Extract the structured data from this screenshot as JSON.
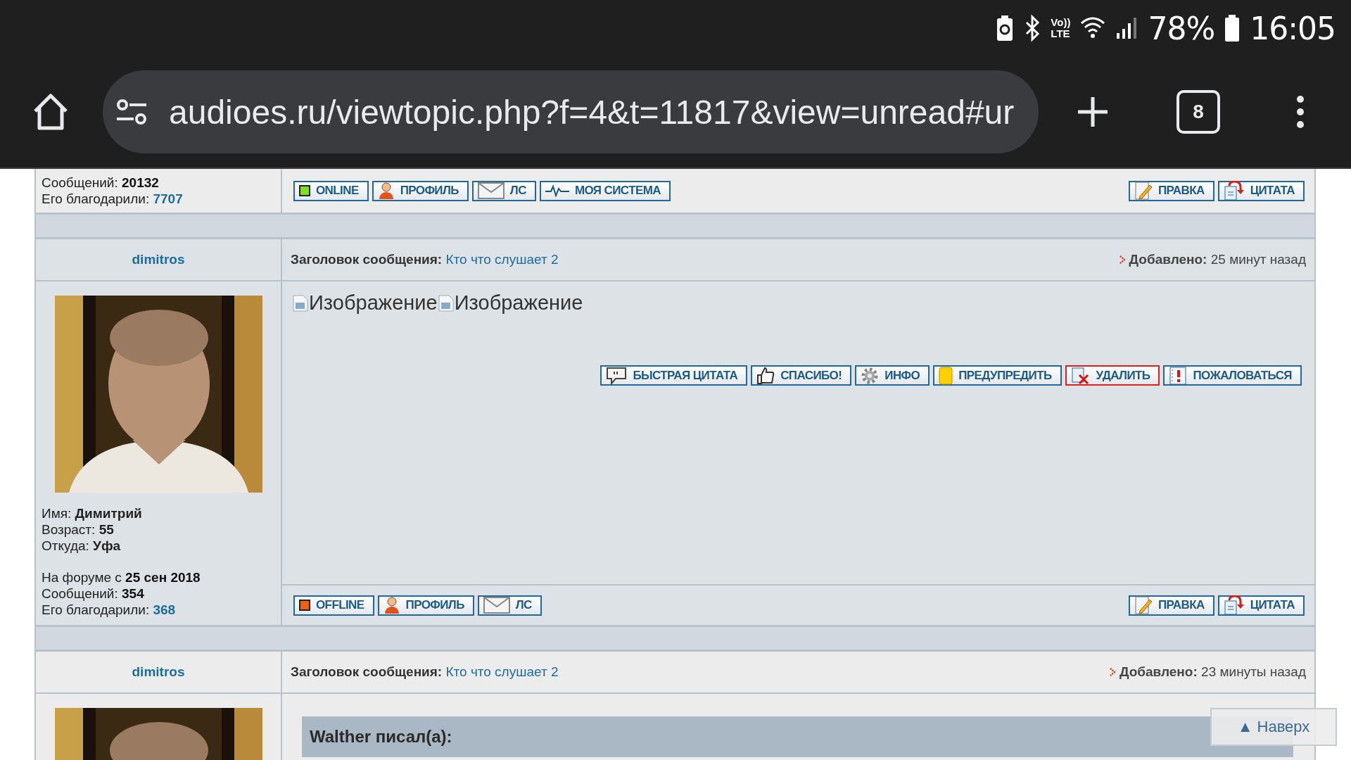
{
  "status_bar": {
    "indicator_top": "Vo))",
    "indicator_bottom": "LTE",
    "battery": "78%",
    "time": "16:05"
  },
  "browser": {
    "url": "audioes.ru/viewtopic.php?f=4&t=11817&view=unread#ur",
    "tab_count": "8"
  },
  "posts": [
    {
      "stats": [
        {
          "label": "Сообщений:",
          "value": "20132",
          "kind": "bold"
        },
        {
          "label": "Его благодарили:",
          "value": "7707",
          "kind": "link"
        }
      ],
      "footer_buttons": [
        {
          "kind": "online",
          "label": "ONLINE"
        },
        {
          "kind": "profile",
          "label": "ПРОФИЛЬ"
        },
        {
          "kind": "pm",
          "label": "ЛС"
        },
        {
          "kind": "system",
          "label": "МОЯ СИСТЕМА"
        }
      ],
      "edit_buttons": [
        {
          "kind": "edit",
          "label": "ПРАВКА"
        },
        {
          "kind": "quote",
          "label": "ЦИТАТА"
        }
      ]
    },
    {
      "author": "dimitros",
      "subject_label": "Заголовок сообщения:",
      "subject": "Кто что слушает 2",
      "added_label": "Добавлено:",
      "added": "25 минут назад",
      "avatar": {
        "kind": "picture"
      },
      "images": [
        "Изображение",
        "Изображение"
      ],
      "action_buttons": [
        {
          "kind": "quickquote",
          "label": "БЫСТРАЯ ЦИТАТА"
        },
        {
          "kind": "thanks",
          "label": "СПАСИБО!"
        },
        {
          "kind": "info",
          "label": "ИНФО"
        },
        {
          "kind": "warn",
          "label": "ПРЕДУПРЕДИТЬ"
        },
        {
          "kind": "delete",
          "label": "УДАЛИТЬ"
        },
        {
          "kind": "report",
          "label": "ПОЖАЛОВАТЬСЯ"
        }
      ],
      "details": [
        {
          "label": "Имя:",
          "value": "Димитрий"
        },
        {
          "label": "Возраст:",
          "value": "55"
        },
        {
          "label": "Откуда:",
          "value": "Уфа"
        }
      ],
      "stats": [
        {
          "label": "На форуме с",
          "value": "25 сен 2018",
          "kind": "bold"
        },
        {
          "label": "Сообщений:",
          "value": "354",
          "kind": "bold"
        },
        {
          "label": "Его благодарили:",
          "value": "368",
          "kind": "link"
        }
      ],
      "footer_buttons": [
        {
          "kind": "offline",
          "label": "OFFLINE"
        },
        {
          "kind": "profile",
          "label": "ПРОФИЛЬ"
        },
        {
          "kind": "pm",
          "label": "ЛС"
        }
      ],
      "edit_buttons": [
        {
          "kind": "edit",
          "label": "ПРАВКА"
        },
        {
          "kind": "quote",
          "label": "ЦИТАТА"
        }
      ]
    },
    {
      "author": "dimitros",
      "subject_label": "Заголовок сообщения:",
      "subject": "Кто что слушает 2",
      "added_label": "Добавлено:",
      "added": "23 минуты назад",
      "avatar": {
        "kind": "picture"
      },
      "quote": {
        "author": "Walther писал(а):"
      }
    }
  ],
  "scroll_top": {
    "arrow": "▲",
    "label": "Наверх"
  }
}
